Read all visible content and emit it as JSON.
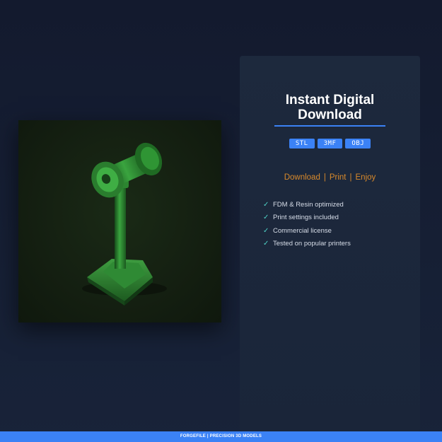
{
  "card": {
    "title_line1": "Instant Digital",
    "title_line2": "Download",
    "formats": [
      "STL",
      "3MF",
      "OBJ"
    ],
    "actions": [
      "Download",
      "Print",
      "Enjoy"
    ],
    "features": [
      "FDM & Resin optimized",
      "Print settings included",
      "Commercial license",
      "Tested on popular printers"
    ]
  },
  "footer": {
    "text": "FORGEFILE | PRECISION 3D MODELS"
  },
  "colors": {
    "accent": "#3b82f6",
    "action_text": "#d98a2b",
    "check": "#4fd1c5",
    "model": "#2f8a34"
  },
  "icons": {
    "check": "check-icon"
  }
}
